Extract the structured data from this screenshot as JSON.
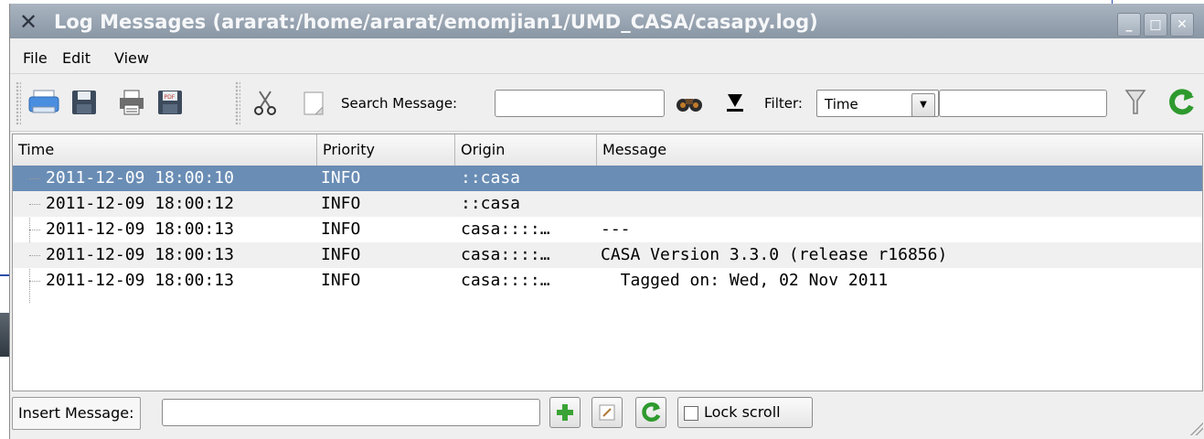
{
  "window": {
    "title": "Log Messages (ararat:/home/ararat/emomjian1/UMD_CASA/casapy.log)",
    "icon": "x-app-icon",
    "controls": {
      "minimize": "_",
      "maximize": "□",
      "close": "✕"
    }
  },
  "menubar": {
    "file": "File",
    "edit": "Edit",
    "view": "View"
  },
  "toolbar": {
    "icons": [
      "print-icon",
      "save-icon",
      "printer-icon",
      "pdf-icon",
      "cut-icon",
      "copy-icon",
      "search-binoculars-icon",
      "filter-down-icon",
      "funnel-icon",
      "refresh-icon"
    ],
    "search_label": "Search Message:",
    "search_value": "",
    "filter_label": "Filter:",
    "filter_selected": "Time",
    "filter_value": ""
  },
  "table": {
    "columns": [
      "Time",
      "Priority",
      "Origin",
      "Message"
    ],
    "rows": [
      {
        "time": "2011-12-09 18:00:10",
        "priority": "INFO",
        "origin": "::casa",
        "message": ""
      },
      {
        "time": "2011-12-09 18:00:12",
        "priority": "INFO",
        "origin": "::casa",
        "message": ""
      },
      {
        "time": "2011-12-09 18:00:13",
        "priority": "INFO",
        "origin": "casa::::…",
        "message": "---"
      },
      {
        "time": "2011-12-09 18:00:13",
        "priority": "INFO",
        "origin": "casa::::…",
        "message": "CASA Version 3.3.0 (release r16856)"
      },
      {
        "time": "2011-12-09 18:00:13",
        "priority": "INFO",
        "origin": "casa::::…",
        "message": "  Tagged on: Wed, 02 Nov 2011"
      }
    ]
  },
  "bottom": {
    "insert_label": "Insert Message:",
    "insert_value": "",
    "lock_scroll_label": "Lock scroll",
    "lock_scroll_checked": false
  },
  "colors": {
    "selection": "#6a8db5",
    "titlebar": "#8996a4"
  }
}
